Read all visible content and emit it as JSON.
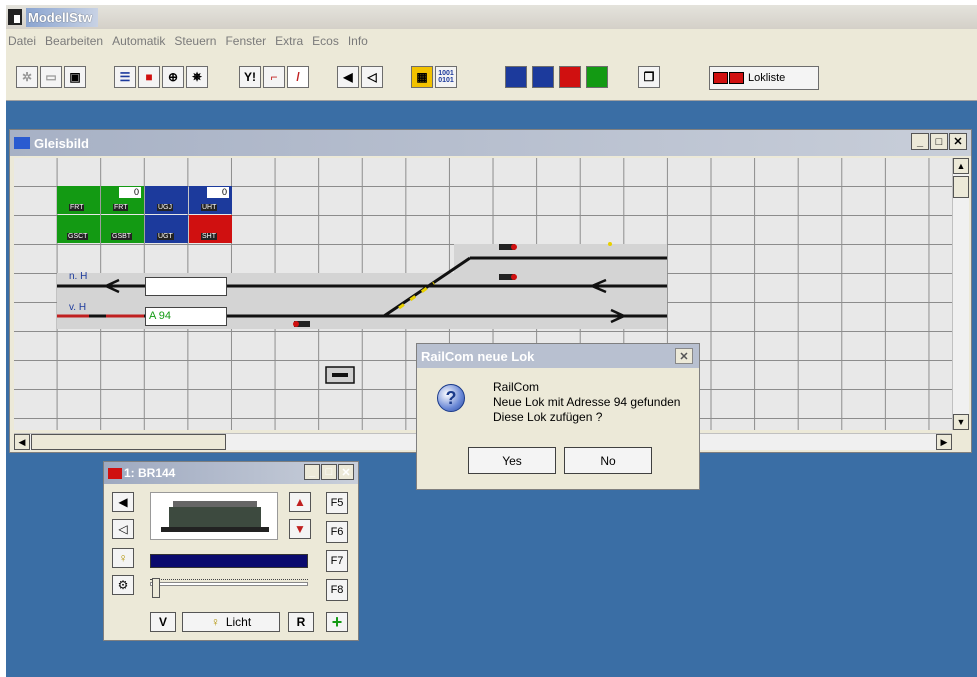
{
  "app": {
    "title": "ModellStw"
  },
  "menu": [
    "Datei",
    "Bearbeiten",
    "Automatik",
    "Steuern",
    "Fenster",
    "Extra",
    "Ecos",
    "Info"
  ],
  "toolbar": {
    "lokliste_label": "Lokliste",
    "binary_label_top": "1001",
    "binary_label_bottom": "0101"
  },
  "gleisbild": {
    "title": "Gleisbild",
    "labels": {
      "n_h": "n. H",
      "v_h": "v. H",
      "train_a94": "A 94"
    },
    "signal_panel": {
      "row1": [
        {
          "code": "FRT",
          "color": "#139a13",
          "count": ""
        },
        {
          "code": "FRT",
          "color": "#139a13",
          "count": "0"
        },
        {
          "code": "UGJ",
          "color": "#1c3a9c",
          "count": ""
        },
        {
          "code": "UHT",
          "color": "#1c3a9c",
          "count": "0"
        }
      ],
      "row2": [
        {
          "code": "GSCT",
          "color": "#139a13"
        },
        {
          "code": "GSBT",
          "color": "#139a13"
        },
        {
          "code": "UGT",
          "color": "#1c3a9c"
        },
        {
          "code": "SHT",
          "color": "#d01010"
        }
      ]
    }
  },
  "dialog": {
    "title": "RailCom neue Lok",
    "line1": "RailCom",
    "line2": "Neue Lok mit Adresse 94 gefunden",
    "line3": "Diese Lok zufügen ?",
    "yes": "Yes",
    "no": "No"
  },
  "loco": {
    "title": "1: BR144",
    "f5": "F5",
    "f6": "F6",
    "f7": "F7",
    "f8": "F8",
    "v_label": "V",
    "licht_label": "Licht",
    "r_label": "R"
  },
  "colors": {
    "desktop": "#3a6ea5",
    "green": "#139a13",
    "blue": "#1c3a9c",
    "red": "#d01010"
  }
}
